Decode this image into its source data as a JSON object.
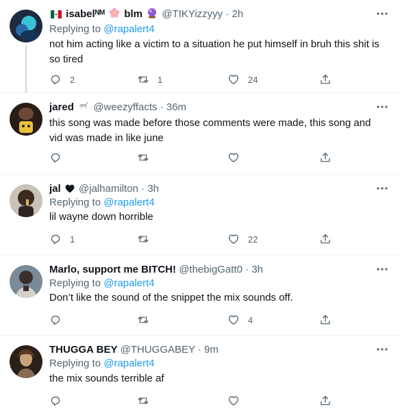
{
  "tweets": [
    {
      "name": "isabelᴺᴹ",
      "name_suffix": "blm",
      "handle": "@TIKYizzyyy",
      "time": "2h",
      "replying_prefix": "Replying to",
      "replying_to": "@rapalert4",
      "text": "not him acting like a victim to a situation he put himself in bruh this shit is so tired",
      "reply_count": "2",
      "retweet_count": "1",
      "like_count": "24",
      "avatar_colors": [
        "#1d2a3f",
        "#39c2d6"
      ]
    },
    {
      "name": "jared",
      "handle": "@weezyffacts",
      "time": "36m",
      "text": "this song was made before those comments were made, this song and vid was made in like june",
      "reply_count": "",
      "retweet_count": "",
      "like_count": "",
      "avatar_colors": [
        "#2a1d18",
        "#e8c23a"
      ]
    },
    {
      "name": "jal",
      "handle": "@jalhamilton",
      "time": "3h",
      "replying_prefix": "Replying to",
      "replying_to": "@rapalert4",
      "text": "lil wayne down horrible",
      "reply_count": "1",
      "retweet_count": "",
      "like_count": "22",
      "avatar_colors": [
        "#c9c2b6",
        "#3b2a20"
      ]
    },
    {
      "name": "Marlo, support me BITCH!",
      "handle": "@thebigGatt0",
      "time": "3h",
      "replying_prefix": "Replying to",
      "replying_to": "@rapalert4",
      "text": "Don’t like the sound of the snippet the mix sounds off.",
      "reply_count": "",
      "retweet_count": "",
      "like_count": "4",
      "avatar_colors": [
        "#7a8a96",
        "#3a2f2a"
      ]
    },
    {
      "name": "THUGGA BEY",
      "handle": "@THUGGABEY",
      "time": "9m",
      "replying_prefix": "Replying to",
      "replying_to": "@rapalert4",
      "text": "the mix sounds terrible af",
      "reply_count": "",
      "retweet_count": "",
      "like_count": "",
      "avatar_colors": [
        "#2b1f1a",
        "#c9a27a"
      ]
    }
  ],
  "colors": {
    "text": "#0f1419",
    "secondary": "#536471",
    "link": "#1d9bf0",
    "divider": "#eff3f4",
    "thread_line": "#cfd9de"
  }
}
